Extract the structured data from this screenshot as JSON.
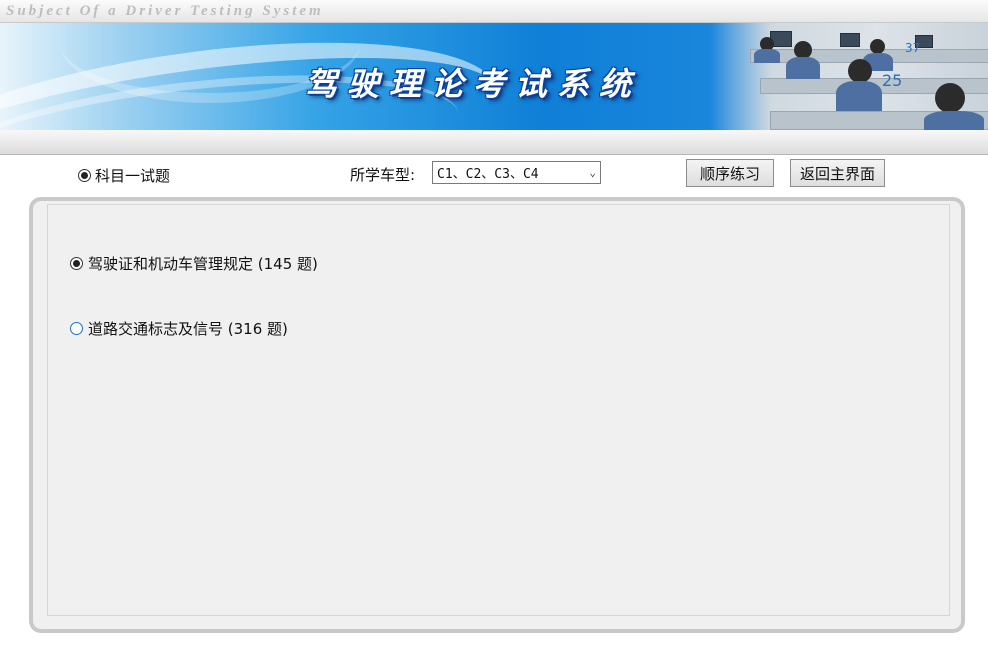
{
  "app": {
    "subtitle": "Subject Of a Driver Testing System",
    "banner_title": "驾驶理论考试系统",
    "photo_numbers": [
      "37",
      "25"
    ]
  },
  "toolbar": {
    "subject_option": "科目一试题",
    "vehicle_label": "所学车型:",
    "vehicle_selected": "C1、C2、C3、C4",
    "sequential_practice_label": "顺序练习",
    "back_main_label": "返回主界面"
  },
  "categories": [
    {
      "label": "驾驶证和机动车管理规定 (145 题)",
      "selected": true
    },
    {
      "label": "道路交通标志及信号 (316 题)",
      "selected": false
    }
  ],
  "colors": {
    "banner_blue": "#0f7fd7",
    "title_outline": "#0a3f9c",
    "panel_bg": "#f0f0f0",
    "radio_unselected": "#1f6fc5"
  }
}
